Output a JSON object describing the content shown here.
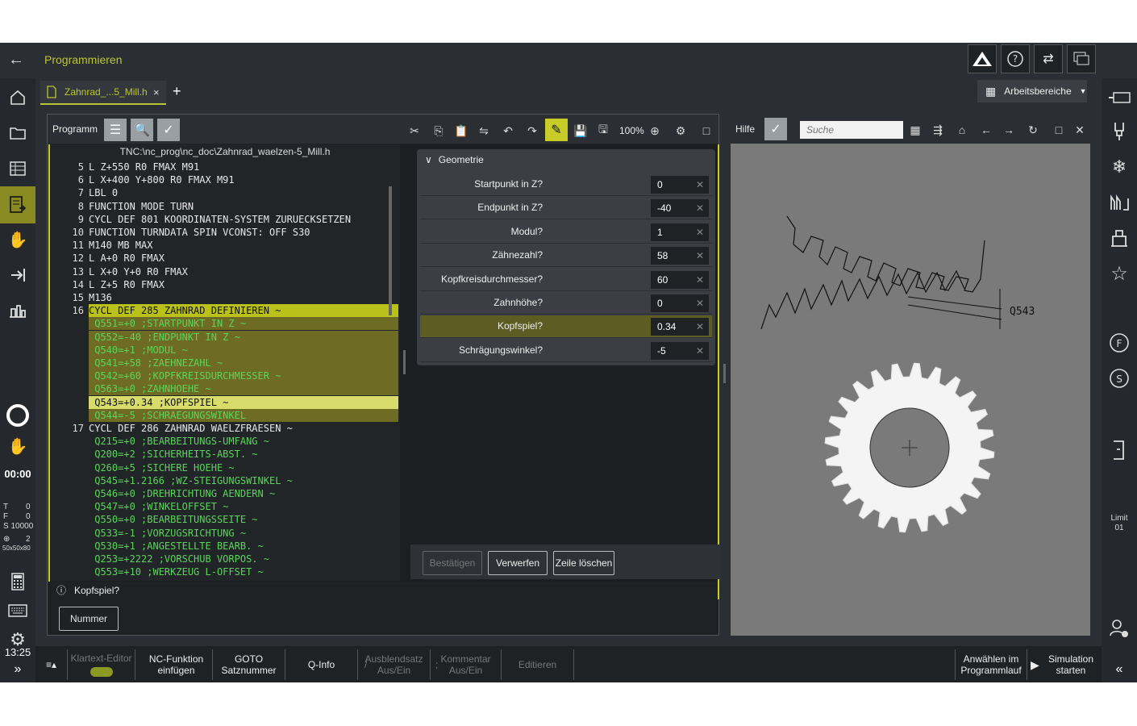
{
  "app": {
    "title": "Programmieren"
  },
  "tabs": {
    "file": "Zahnrad_...5_Mill.h",
    "close": "×",
    "add": "+",
    "workspaces": "Arbeitsbereiche"
  },
  "program": {
    "title": "Programm",
    "zoom": "100%",
    "path": "TNC:\\nc_prog\\nc_doc\\Zahnrad_waelzen-5_Mill.h"
  },
  "lines": [
    {
      "n": "5",
      "t": "L Z+550 R0 FMAX M91"
    },
    {
      "n": "6",
      "t": "L X+400 Y+800 R0 FMAX M91"
    },
    {
      "n": "7",
      "t": "LBL 0"
    },
    {
      "n": "8",
      "t": "FUNCTION MODE TURN"
    },
    {
      "n": "9",
      "t": "CYCL DEF 801 KOORDINATEN-SYSTEM ZURUECKSETZEN"
    },
    {
      "n": "10",
      "t": "FUNCTION TURNDATA SPIN VCONST: OFF S30"
    },
    {
      "n": "11",
      "t": "M140 MB MAX"
    },
    {
      "n": "12",
      "t": "L A+0 R0 FMAX"
    },
    {
      "n": "13",
      "t": "L X+0 Y+0 R0 FMAX"
    },
    {
      "n": "14",
      "t": "L Z+5 R0 FMAX"
    },
    {
      "n": "15",
      "t": "M136"
    },
    {
      "n": "16",
      "t": "CYCL DEF 285 ZAHNRAD DEFINIEREN ~"
    },
    {
      "n": "",
      "t": " Q551=+0 ;STARTPUNKT IN Z ~"
    },
    {
      "n": "",
      "t": " Q552=-40 ;ENDPUNKT IN Z ~"
    },
    {
      "n": "",
      "t": " Q540=+1 ;MODUL ~"
    },
    {
      "n": "",
      "t": " Q541=+58 ;ZAEHNEZAHL ~"
    },
    {
      "n": "",
      "t": " Q542=+60 ;KOPFKREISDURCHMESSER ~"
    },
    {
      "n": "",
      "t": " Q563=+0 ;ZAHNHOEHE ~"
    },
    {
      "n": "",
      "t": " Q543=+0.34 ;KOPFSPIEL ~"
    },
    {
      "n": "",
      "t": " Q544=-5 ;SCHRAEGUNGSWINKEL"
    },
    {
      "n": "17",
      "t": "CYCL DEF 286 ZAHNRAD WAELZFRAESEN ~"
    },
    {
      "n": "",
      "t": " Q215=+0 ;BEARBEITUNGS-UMFANG ~"
    },
    {
      "n": "",
      "t": " Q200=+2 ;SICHERHEITS-ABST. ~"
    },
    {
      "n": "",
      "t": " Q260=+5 ;SICHERE HOEHE ~"
    },
    {
      "n": "",
      "t": " Q545=+1.2166 ;WZ-STEIGUNGSWINKEL ~"
    },
    {
      "n": "",
      "t": " Q546=+0 ;DREHRICHTUNG AENDERN ~"
    },
    {
      "n": "",
      "t": " Q547=+0 ;WINKELOFFSET ~"
    },
    {
      "n": "",
      "t": " Q550=+0 ;BEARBEITUNGSSEITE ~"
    },
    {
      "n": "",
      "t": " Q533=-1 ;VORZUGSRICHTUNG ~"
    },
    {
      "n": "",
      "t": " Q530=+1 ;ANGESTELLTE BEARB. ~"
    },
    {
      "n": "",
      "t": " Q253=+2222 ;VORSCHUB VORPOS. ~"
    },
    {
      "n": "",
      "t": " Q553=+10 ;WERKZEUG L-OFFSET ~"
    }
  ],
  "form": {
    "title": "Geometrie",
    "fields": [
      {
        "label": "Startpunkt in Z?",
        "value": "0"
      },
      {
        "label": "Endpunkt in Z?",
        "value": "-40"
      },
      {
        "label": "Modul?",
        "value": "1"
      },
      {
        "label": "Zähnezahl?",
        "value": "58"
      },
      {
        "label": "Kopfkreisdurchmesser?",
        "value": "60"
      },
      {
        "label": "Zahnhöhe?",
        "value": "0"
      },
      {
        "label": "Kopfspiel?",
        "value": "0.34"
      },
      {
        "label": "Schrägungswinkel?",
        "value": "-5"
      }
    ],
    "confirm": "Bestätigen",
    "discard": "Verwerfen",
    "delete_line": "Zeile löschen"
  },
  "status": {
    "prompt": "Kopfspiel?",
    "number_btn": "Nummer"
  },
  "help": {
    "title": "Hilfe",
    "search_placeholder": "Suche",
    "figure_label": "Q543"
  },
  "left": {
    "time": "00:00",
    "T": "T",
    "T_val": "0",
    "F": "F",
    "F_val": "0",
    "S": "S 10000",
    "blank_icon": "2",
    "blank_size": "50x50x80",
    "clock": "13:25"
  },
  "right": {
    "limit": "Limit",
    "limit_num": "01"
  },
  "bottom": {
    "klartext": "Klartext-Editor",
    "nc1": "NC-Funktion",
    "nc2": "einfügen",
    "goto1": "GOTO",
    "goto2": "Satznummer",
    "qinfo": "Q-Info",
    "aus1": "Ausblendsatz",
    "aus2": "Aus/Ein",
    "kom1": "Kommentar",
    "kom2": "Aus/Ein",
    "edit": "Editieren",
    "sel1": "Anwählen im",
    "sel2": "Programmlauf",
    "sim1": "Simulation",
    "sim2": "starten"
  }
}
